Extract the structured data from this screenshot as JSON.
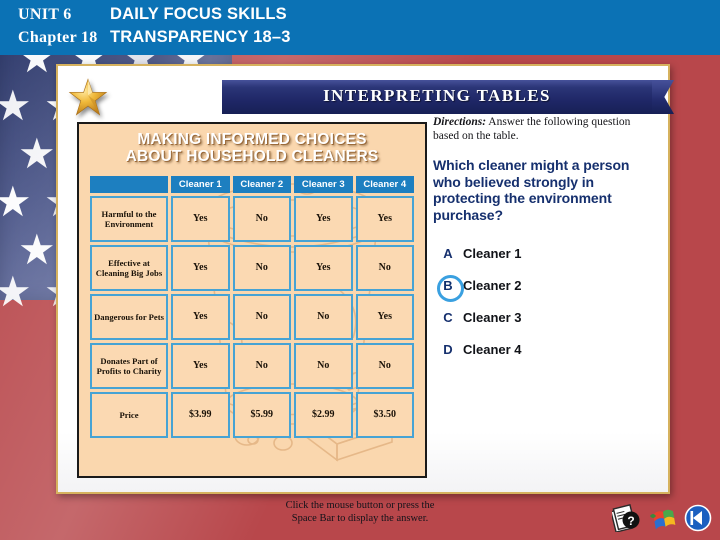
{
  "header": {
    "unit_label": "UNIT 6",
    "chapter_label": "Chapter 18",
    "title_line1": "DAILY FOCUS SKILLS",
    "title_line2": "TRANSPARENCY 18–3",
    "bar_color": "#0b72b5"
  },
  "banner": {
    "title": "INTERPRETING TABLES",
    "color": "#1f2767"
  },
  "table_card": {
    "title_line1": "MAKING INFORMED CHOICES",
    "title_line2": "ABOUT HOUSEHOLD CLEANERS",
    "background": "#fad7ae",
    "header_color": "#1d7fc0",
    "grid_line_color": "#46a3d4",
    "columns": [
      "",
      "Cleaner 1",
      "Cleaner 2",
      "Cleaner 3",
      "Cleaner 4"
    ],
    "rows": [
      {
        "label": "Harmful to the Environment",
        "values": [
          "Yes",
          "No",
          "Yes",
          "Yes"
        ]
      },
      {
        "label": "Effective at Cleaning Big Jobs",
        "values": [
          "Yes",
          "No",
          "Yes",
          "No"
        ]
      },
      {
        "label": "Dangerous for Pets",
        "values": [
          "Yes",
          "No",
          "No",
          "Yes"
        ]
      },
      {
        "label": "Donates Part of Profits to Charity",
        "values": [
          "Yes",
          "No",
          "No",
          "No"
        ]
      },
      {
        "label": "Price",
        "values": [
          "$3.99",
          "$5.99",
          "$2.99",
          "$3.50"
        ]
      }
    ]
  },
  "question_panel": {
    "directions_label": "Directions:",
    "directions_text": " Answer the following question based on the table.",
    "question": "Which cleaner might a person who believed strongly in protecting the environment purchase?",
    "choices": [
      {
        "letter": "A",
        "text": "Cleaner 1",
        "selected": false
      },
      {
        "letter": "B",
        "text": "Cleaner 2",
        "selected": true
      },
      {
        "letter": "C",
        "text": "Cleaner 3",
        "selected": false
      },
      {
        "letter": "D",
        "text": "Cleaner 4",
        "selected": false
      }
    ],
    "selection_ring_color": "#3aa0e0"
  },
  "footer": {
    "line1": "Click the mouse button or press the",
    "line2": "Space Bar to display the answer."
  },
  "nav_icons": [
    {
      "name": "help-icon",
      "label": "?"
    },
    {
      "name": "windows-icon",
      "label": ""
    },
    {
      "name": "back-icon",
      "label": "◀"
    }
  ]
}
